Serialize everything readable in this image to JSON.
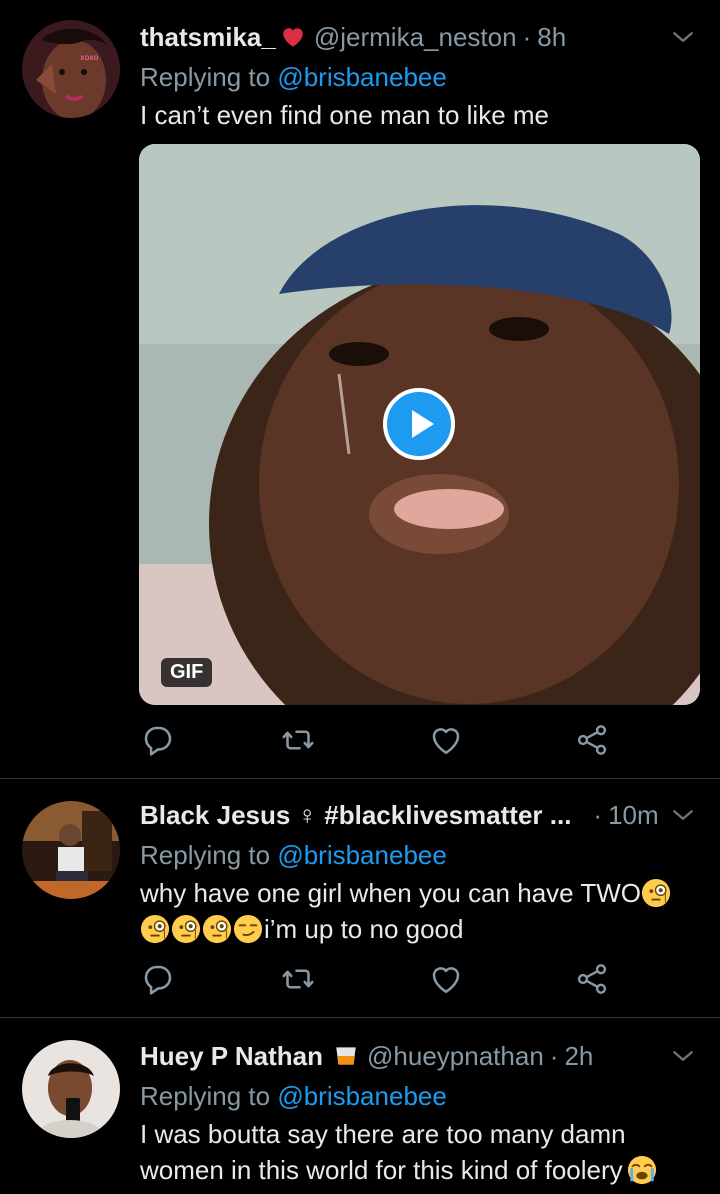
{
  "tweets": [
    {
      "name": "thatsmika_",
      "name_emoji": "red-heart",
      "handle": "@jermika_neston",
      "time": "8h",
      "replying_prefix": "Replying to ",
      "replying_to": "@brisbanebee",
      "text": "I can’t even find one man to like me",
      "media_badge": "GIF"
    },
    {
      "name": "Black Jesus ♀ #blacklivesmatter ...",
      "handle": "",
      "time": "10m",
      "replying_prefix": "Replying to ",
      "replying_to": "@brisbanebee",
      "text_line1": "why have one girl when you can have TWO",
      "text_line2": "i’m up to no good",
      "emojis": [
        "face-with-monocle",
        "face-with-monocle",
        "face-with-monocle",
        "face-with-monocle",
        "smirking-face"
      ]
    },
    {
      "name": "Huey P Nathan",
      "name_emoji": "tumbler-glass",
      "handle": "@hueypnathan",
      "time": "2h",
      "replying_prefix": "Replying to ",
      "replying_to": "@brisbanebee",
      "text": "I was boutta say there are too many damn women in this world for this kind of foolery",
      "text_emoji": "loudly-crying-face"
    }
  ],
  "icons": [
    "reply-icon",
    "retweet-icon",
    "like-icon",
    "share-icon",
    "chevron-down-icon",
    "play-icon"
  ],
  "colors": {
    "background": "#000000",
    "link": "#1d9bf0",
    "muted": "#8899a6",
    "text": "#e7e9ea",
    "divider": "#2f3336"
  }
}
